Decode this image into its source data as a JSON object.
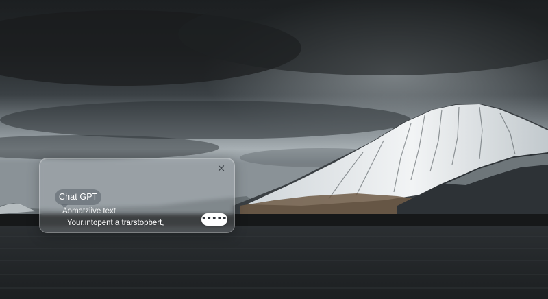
{
  "panel": {
    "close_glyph": "×",
    "chip_label": "Chat GPT",
    "subtitle": "Aomatziive text",
    "message": "Your.intopent a trarstopbert,",
    "send_glyph": "•••••"
  },
  "colors": {
    "sky": "#2a2d30",
    "snow": "#e8ecef",
    "water": "#222528",
    "panel_tint": "#d7dce1"
  }
}
